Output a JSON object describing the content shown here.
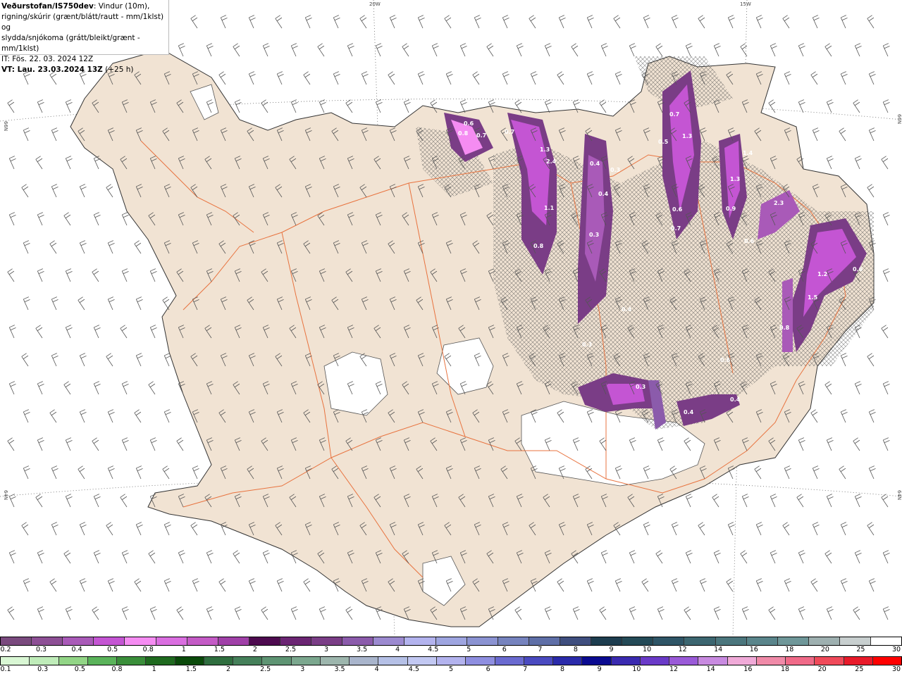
{
  "info": {
    "title": "Veðurstofan/IS750dev",
    "title_suffix": ": Vindur (10m),",
    "line2": "rigning/skúrir (grænt/blátt/rautt - mm/1klst) og",
    "line3": "slydda/snjókoma (grátt/bleikt/grænt - mm/1klst)",
    "it_line": "IT: Fös. 22. 03. 2024 12Z",
    "vt_label": "VT: Lau. 23.03.2024 13Z",
    "vt_suffix": " (+25 h)"
  },
  "grid_labels": {
    "lon_20": "20W",
    "lon_15": "15W",
    "lat_66_left": "66N",
    "lat_66_right": "66N",
    "lat_64_left": "64N",
    "lat_64_right": "64N"
  },
  "colors": {
    "land": "#f1e3d3",
    "glacier": "#ffffff",
    "roads": "#e8733f",
    "snow_dark": "#7a3d86",
    "snow_mid": "#c455d3",
    "snow_light": "#f58cf2"
  },
  "map_value_labels": [
    "0.6",
    "0.8",
    "0.7",
    "1.3",
    "2.4",
    "1.1",
    "0.7",
    "0.3",
    "0.4",
    "0.8",
    "0.4",
    "0.3",
    "0.4",
    "0.7",
    "0.5",
    "1.3",
    "0.7",
    "0.6",
    "1.4",
    "1.3",
    "0.9",
    "2.3",
    "0.6",
    "1.5",
    "1.2",
    "0.8",
    "0.6",
    "0.4",
    "0.3",
    "0.4",
    "0.3",
    "0.6"
  ],
  "legend_top": {
    "colors": [
      "#7a4a7e",
      "#8d4f95",
      "#a95ab8",
      "#c455d3",
      "#f58cf2",
      "#da6ee0",
      "#c45bc6",
      "#a040a8",
      "#4d0a4f",
      "#6b2573",
      "#7a3d86",
      "#8b5bab",
      "#9c8ad0",
      "#b3b3ee",
      "#9ea5e0",
      "#8b93d2",
      "#7683be",
      "#5f6fa7",
      "#3f4e7e",
      "#1d3d4f",
      "#244a57",
      "#2e5566",
      "#3c6670",
      "#4b767d",
      "#5a858b",
      "#6f9799",
      "#9eb0b0",
      "#c8cfcf",
      "#ffffff"
    ],
    "labels": [
      "0.2",
      "0.3",
      "0.4",
      "0.5",
      "0.8",
      "1",
      "1.5",
      "2",
      "2.5",
      "3",
      "3.5",
      "4",
      "4.5",
      "5",
      "6",
      "7",
      "8",
      "9",
      "10",
      "12",
      "14",
      "16",
      "18",
      "20",
      "25",
      "30"
    ]
  },
  "legend_bottom": {
    "colors": [
      "#d9f7d4",
      "#bfecb9",
      "#92d586",
      "#5ab35a",
      "#3a8e3a",
      "#1f6a1f",
      "#0a4a0a",
      "#2f6e3f",
      "#45805a",
      "#5e9473",
      "#7ba78e",
      "#9db6ad",
      "#a9b5cc",
      "#b5c0e6",
      "#c2c8f2",
      "#b3b3ee",
      "#8e8ee0",
      "#6a6ad0",
      "#4a4ac0",
      "#2a2aaa",
      "#0a0a90",
      "#3a2ab0",
      "#6a3ac8",
      "#9a5ad8",
      "#c88ae0",
      "#f0aad8",
      "#f08aa8",
      "#f06a88",
      "#f04a5a",
      "#e81a2a",
      "#ff0000"
    ],
    "labels": [
      "0.1",
      "0.3",
      "0.5",
      "0.8",
      "1",
      "1.5",
      "2",
      "2.5",
      "3",
      "3.5",
      "4",
      "4.5",
      "5",
      "6",
      "7",
      "8",
      "9",
      "10",
      "12",
      "14",
      "16",
      "18",
      "20",
      "25",
      "30"
    ]
  }
}
